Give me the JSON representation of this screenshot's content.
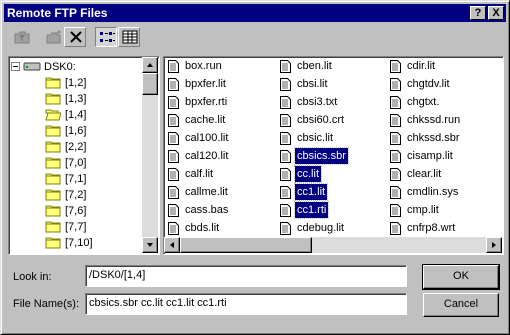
{
  "window": {
    "title": "Remote FTP Files",
    "help_label": "?",
    "close_label": "X"
  },
  "toolbar": {
    "buttons": [
      {
        "icon": "up-folder-icon"
      },
      {
        "icon": "new-folder-icon"
      },
      {
        "icon": "delete-icon"
      },
      {
        "icon": "list-view-icon",
        "pressed": true
      },
      {
        "icon": "details-view-icon"
      }
    ]
  },
  "tree": {
    "root": "DSK0:",
    "items": [
      "[1,2]",
      "[1,3]",
      "[1,4]",
      "[1,6]",
      "[2,2]",
      "[7,0]",
      "[7,1]",
      "[7,2]",
      "[7,6]",
      "[7,7]",
      "[7,10]"
    ],
    "open_item": "[1,4]"
  },
  "files": {
    "columns": [
      [
        "box.run",
        "bpxfer.lit",
        "bpxfer.rti",
        "cache.lit",
        "cal100.lit",
        "cal120.lit",
        "calf.lit",
        "callme.lit",
        "cass.bas",
        "cbds.lit"
      ],
      [
        "cben.lit",
        "cbsi.lit",
        "cbsi3.txt",
        "cbsi60.crt",
        "cbsic.lit",
        "cbsics.sbr",
        "cc.lit",
        "cc1.lit",
        "cc1.rti",
        "cdebug.lit"
      ],
      [
        "cdir.lit",
        "chgtdv.lit",
        "chgtxt.",
        "chkssd.run",
        "chkssd.sbr",
        "cisamp.lit",
        "clear.lit",
        "cmdlin.sys",
        "cmp.lit",
        "cnfrp8.wrt"
      ]
    ],
    "selected": [
      "cbsics.sbr",
      "cc.lit",
      "cc1.lit",
      "cc1.rti"
    ]
  },
  "look_in": {
    "label": "Look in:",
    "value": "/DSK0/[1,4]"
  },
  "file_names": {
    "label": "File Name(s):",
    "value": "cbsics.sbr cc.lit cc1.lit cc1.rti"
  },
  "buttons": {
    "ok": "OK",
    "cancel": "Cancel"
  },
  "colors": {
    "title_bar": "#000080",
    "selection": "#000080",
    "face": "#c0c0c0"
  }
}
